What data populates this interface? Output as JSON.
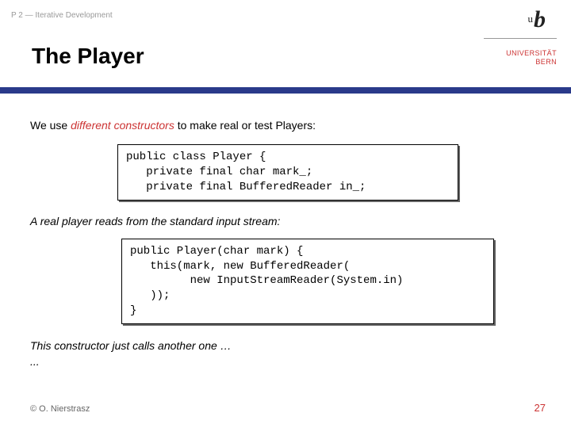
{
  "header": {
    "breadcrumb": "P 2 — Iterative Development",
    "title": "The Player"
  },
  "logo": {
    "mark_sup": "u",
    "mark_main": "b",
    "uni_line1": "UNIVERSITÄT",
    "uni_line2": "BERN"
  },
  "body": {
    "intro_pre": "We use ",
    "intro_em": "different constructors",
    "intro_post": " to make real or test Players:",
    "code1": "public class Player {\n   private final char mark_;\n   private final BufferedReader in_;",
    "mid": "A real player reads from the standard input stream:",
    "code2": "public Player(char mark) {\n   this(mark, new BufferedReader(\n         new InputStreamReader(System.in)\n   ));\n}",
    "tail1": "This constructor just calls another one …",
    "tail2": "..."
  },
  "footer": {
    "copyright": "© O. Nierstrasz",
    "page": "27"
  }
}
